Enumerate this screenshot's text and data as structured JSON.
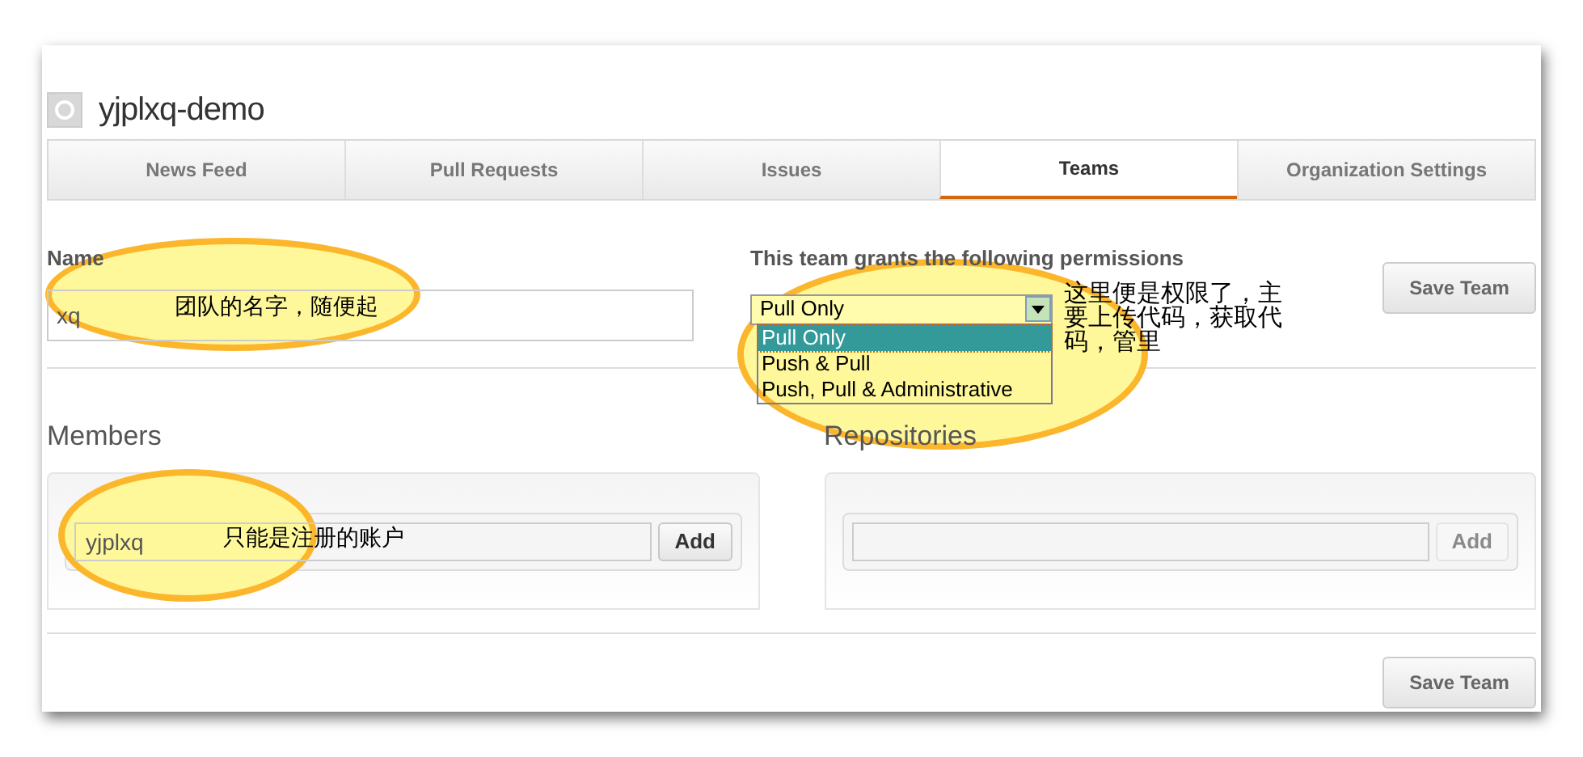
{
  "header": {
    "org_name": "yjplxq-demo"
  },
  "tabs": [
    {
      "label": "News Feed",
      "selected": false
    },
    {
      "label": "Pull Requests",
      "selected": false
    },
    {
      "label": "Issues",
      "selected": false
    },
    {
      "label": "Teams",
      "selected": true
    },
    {
      "label": "Organization Settings",
      "selected": false
    }
  ],
  "team_form": {
    "name_label": "Name",
    "name_value": "xq",
    "permissions_label": "This team grants the following permissions",
    "permission_select": {
      "value": "Pull Only",
      "expanded": true,
      "options": [
        {
          "label": "Pull Only",
          "selected": true
        },
        {
          "label": "Push & Pull",
          "selected": false
        },
        {
          "label": "Push, Pull & Administrative",
          "selected": false
        }
      ]
    },
    "save_button": "Save Team"
  },
  "members": {
    "heading": "Members",
    "input_value": "yjplxq",
    "add_button": "Add",
    "add_disabled": false
  },
  "repositories": {
    "heading": "Repositories",
    "add_button": "Add",
    "add_disabled": true
  },
  "footer": {
    "save_button": "Save Team"
  },
  "annotations": [
    {
      "text": "团队的名字，随便起"
    },
    {
      "text": "这里便是权限了，主要上传代码，获取代码，管里"
    },
    {
      "text": "只能是注册的账户"
    }
  ]
}
